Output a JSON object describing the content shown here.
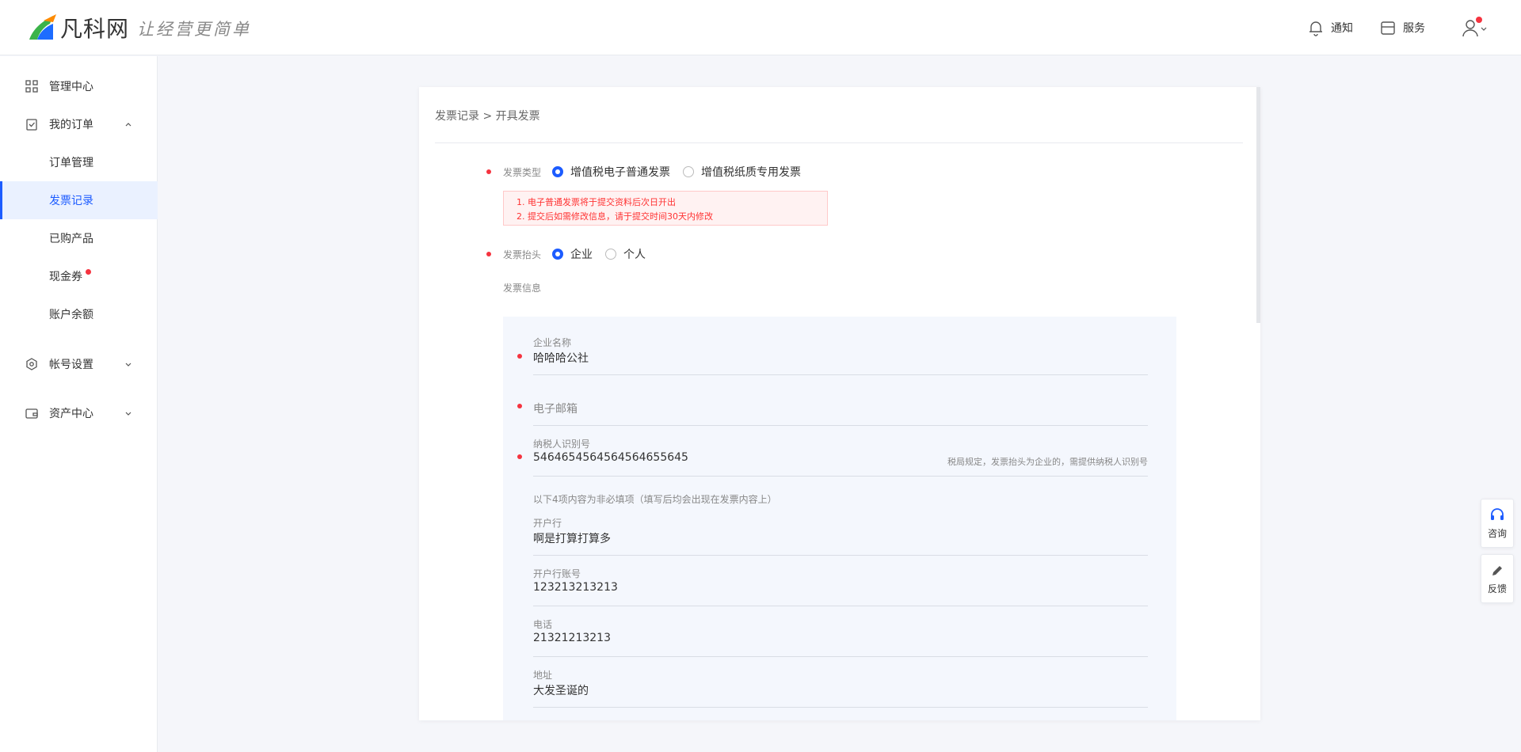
{
  "header": {
    "brand": "凡科网",
    "slogan": "让经营更简单",
    "notify_label": "通知",
    "service_label": "服务"
  },
  "sidebar": {
    "items": [
      {
        "label": "管理中心",
        "icon": "grid-icon"
      },
      {
        "label": "我的订单",
        "icon": "clipboard-check-icon",
        "expanded": true
      },
      {
        "label": "订单管理"
      },
      {
        "label": "发票记录",
        "active": true
      },
      {
        "label": "已购产品"
      },
      {
        "label": "现金券",
        "badge_dot": true
      },
      {
        "label": "账户余额"
      },
      {
        "label": "帐号设置",
        "icon": "gear-icon"
      },
      {
        "label": "资产中心",
        "icon": "wallet-icon"
      }
    ]
  },
  "main": {
    "breadcrumb": "发票记录 > 开具发票",
    "invoice_type": {
      "label": "发票类型",
      "options": [
        "增值税电子普通发票",
        "增值税纸质专用发票"
      ],
      "selected": 0
    },
    "notice": [
      "1. 电子普通发票将于提交资料后次日开出",
      "2. 提交后如需修改信息，请于提交时间30天内修改"
    ],
    "invoice_title": {
      "label": "发票抬头",
      "options": [
        "企业",
        "个人"
      ],
      "selected": 0
    },
    "invoice_info_label": "发票信息",
    "fields": {
      "company_name": {
        "label": "企业名称",
        "value": "哈哈哈公社"
      },
      "email": {
        "placeholder": "电子邮箱"
      },
      "tax_id": {
        "label": "纳税人识别号",
        "value": "5464654564564564655645",
        "hint": "税局规定，发票抬头为企业的，需提供纳税人识别号"
      },
      "optional_note": "以下4项内容为非必填项（填写后均会出现在发票内容上）",
      "bank": {
        "label": "开户行",
        "value": "啊是打算打算多"
      },
      "bank_account": {
        "label": "开户行账号",
        "value": "123213213213"
      },
      "phone": {
        "label": "电话",
        "value": "21321213213"
      },
      "address": {
        "label": "地址",
        "value": "大发圣诞的"
      }
    }
  },
  "floating": {
    "consult_label": "咨询",
    "feedback_label": "反馈"
  },
  "colors": {
    "accent": "#1d5cff",
    "required": "#f5333f",
    "notice_text": "#ff3333",
    "page_bg": "#f5f6fa"
  }
}
